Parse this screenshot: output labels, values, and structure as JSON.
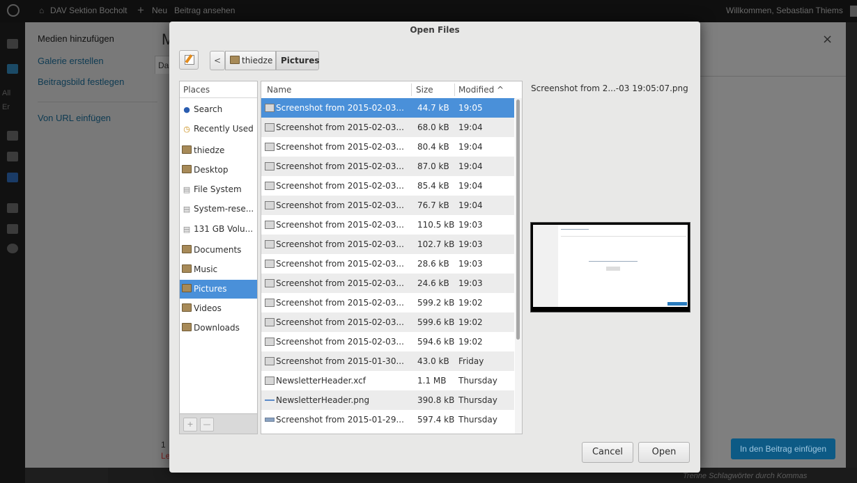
{
  "adminbar": {
    "site_name": "DAV Sektion Bocholt",
    "new_label": "Neu",
    "view_post": "Beitrag ansehen",
    "greeting": "Willkommen, Sebastian Thiems"
  },
  "wpmenu": {
    "frag1": "All",
    "frag2": "Er"
  },
  "media_modal": {
    "menu": [
      "Medien hinzufügen",
      "Galerie erstellen",
      "Beitragsbild festlegen",
      "Von URL einfügen"
    ],
    "title_fragment": "M",
    "tab_fragment": "Da",
    "footer_fragment_1": "1",
    "footer_fragment_2": "Le",
    "insert_button": "In den Beitrag einfügen",
    "close": "×",
    "tags_hint": "Trenne Schlagwörter durch Kommas"
  },
  "dialog": {
    "title": "Open Files",
    "path": [
      "thiedze",
      "Pictures"
    ],
    "back": "<",
    "places_header": "Places",
    "places": [
      {
        "label": "Search",
        "icon": "search-icon"
      },
      {
        "label": "Recently Used",
        "icon": "clock-icon"
      },
      {
        "label": "thiedze",
        "icon": "home-folder-icon"
      },
      {
        "label": "Desktop",
        "icon": "desktop-folder-icon"
      },
      {
        "label": "File System",
        "icon": "drive-icon"
      },
      {
        "label": "System-rese...",
        "icon": "drive-icon"
      },
      {
        "label": "131 GB Volu...",
        "icon": "drive-icon"
      },
      {
        "label": "Documents",
        "icon": "documents-folder-icon"
      },
      {
        "label": "Music",
        "icon": "music-folder-icon"
      },
      {
        "label": "Pictures",
        "icon": "pictures-folder-icon"
      },
      {
        "label": "Videos",
        "icon": "videos-folder-icon"
      },
      {
        "label": "Downloads",
        "icon": "downloads-folder-icon"
      }
    ],
    "selected_place": "Pictures",
    "add_place": "+",
    "remove_place": "—",
    "columns": {
      "name": "Name",
      "size": "Size",
      "modified": "Modified ^"
    },
    "files": [
      {
        "name": "Screenshot from 2015-02-03...",
        "size": "44.7 kB",
        "modified": "19:05"
      },
      {
        "name": "Screenshot from 2015-02-03...",
        "size": "68.0 kB",
        "modified": "19:04"
      },
      {
        "name": "Screenshot from 2015-02-03...",
        "size": "80.4 kB",
        "modified": "19:04"
      },
      {
        "name": "Screenshot from 2015-02-03...",
        "size": "87.0 kB",
        "modified": "19:04"
      },
      {
        "name": "Screenshot from 2015-02-03...",
        "size": "85.4 kB",
        "modified": "19:04"
      },
      {
        "name": "Screenshot from 2015-02-03...",
        "size": "76.7 kB",
        "modified": "19:04"
      },
      {
        "name": "Screenshot from 2015-02-03...",
        "size": "110.5 kB",
        "modified": "19:03"
      },
      {
        "name": "Screenshot from 2015-02-03...",
        "size": "102.7 kB",
        "modified": "19:03"
      },
      {
        "name": "Screenshot from 2015-02-03...",
        "size": "28.6 kB",
        "modified": "19:03"
      },
      {
        "name": "Screenshot from 2015-02-03...",
        "size": "24.6 kB",
        "modified": "19:03"
      },
      {
        "name": "Screenshot from 2015-02-03...",
        "size": "599.2 kB",
        "modified": "19:02"
      },
      {
        "name": "Screenshot from 2015-02-03...",
        "size": "599.6 kB",
        "modified": "19:02"
      },
      {
        "name": "Screenshot from 2015-02-03...",
        "size": "594.6 kB",
        "modified": "19:02"
      },
      {
        "name": "Screenshot from 2015-01-30...",
        "size": "43.0 kB",
        "modified": "Friday"
      },
      {
        "name": "NewsletterHeader.xcf",
        "size": "1.1 MB",
        "modified": "Thursday"
      },
      {
        "name": "NewsletterHeader.png",
        "size": "390.8 kB",
        "modified": "Thursday"
      },
      {
        "name": "Screenshot from 2015-01-29...",
        "size": "597.4 kB",
        "modified": "Thursday"
      }
    ],
    "selected_file_index": 0,
    "preview_filename": "Screenshot from 2...-03 19:05:07.png",
    "cancel": "Cancel",
    "open": "Open"
  },
  "colors": {
    "selection": "#4a90d9",
    "insert_button": "#0d5a85"
  }
}
